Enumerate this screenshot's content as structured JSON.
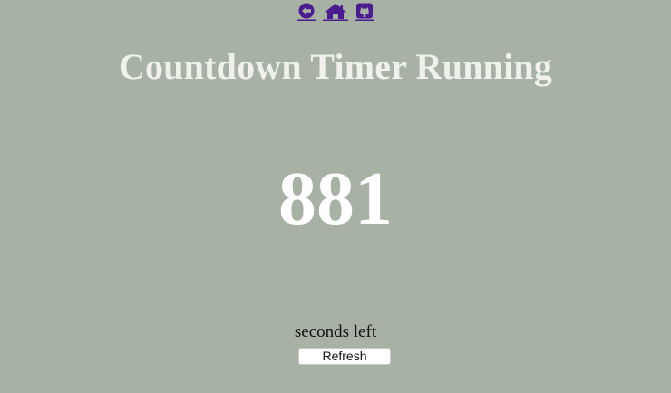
{
  "nav": {
    "icons": [
      "back-arrow-icon",
      "home-icon",
      "github-icon"
    ],
    "icon_color": "#4b1c8f"
  },
  "page": {
    "title": "Countdown Timer Running",
    "counter": "881",
    "caption": "seconds left",
    "refresh_label": "Refresh",
    "background_color": "#a7b1a4"
  }
}
